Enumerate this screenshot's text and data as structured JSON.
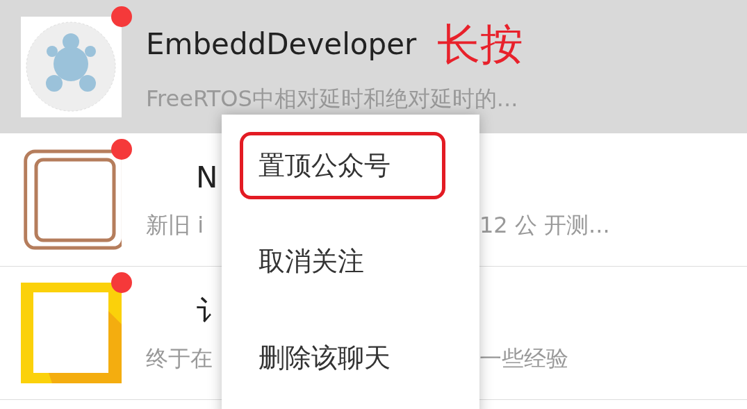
{
  "conversations": [
    {
      "kind": "logo",
      "title": "EmbeddDeveloper",
      "preview": "FreeRTOS中相对延时和绝对延时的...",
      "unread": true,
      "selected": true
    },
    {
      "kind": "brown-frame",
      "title": "N",
      "preview": "新旧 i",
      "preview_tail": "12 公 开测...",
      "unread": true,
      "selected": false
    },
    {
      "kind": "yellow-frame",
      "title": "讠",
      "preview": "终于在",
      "preview_tail": "一些经验",
      "unread": true,
      "selected": false
    }
  ],
  "annotation": "长按",
  "context_menu": [
    {
      "label": "置顶公众号",
      "highlighted": true
    },
    {
      "label": "取消关注",
      "highlighted": false
    },
    {
      "label": "删除该聊天",
      "highlighted": false
    }
  ]
}
